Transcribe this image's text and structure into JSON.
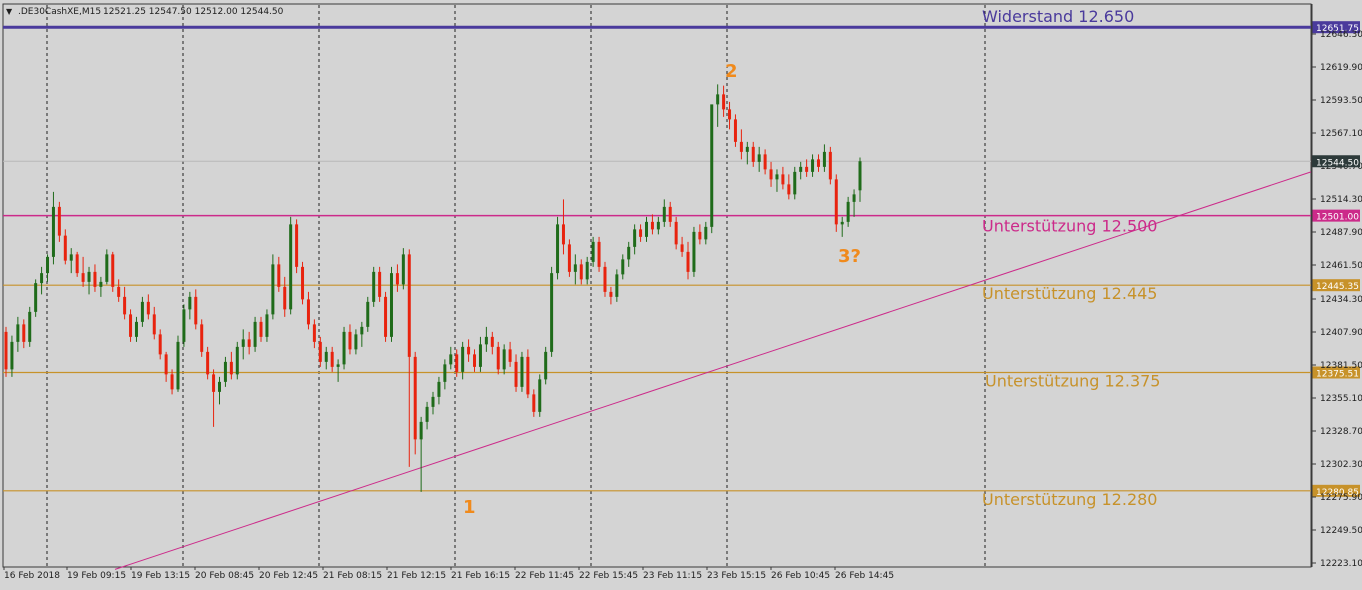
{
  "header": {
    "dropdown_glyph": "▼",
    "symbol": ".DE30CashXE,M15",
    "ohlc": "12521.25 12547.50 12512.00 12544.50"
  },
  "chart_data": {
    "type": "candlestick",
    "symbol": ".DE30CashXE",
    "timeframe": "M15",
    "ylim": [
      12223.1,
      12672.0
    ],
    "y_ticks": [
      "12646.30",
      "12619.90",
      "12593.50",
      "12567.10",
      "12540.70",
      "12514.30",
      "12487.90",
      "12461.50",
      "12434.30",
      "12407.90",
      "12381.50",
      "12355.10",
      "12328.70",
      "12302.30",
      "12275.90",
      "12249.50",
      "12223.10"
    ],
    "x_ticks": [
      "16 Feb 2018",
      "19 Feb 09:15",
      "19 Feb 13:15",
      "20 Feb 08:45",
      "20 Feb 12:45",
      "21 Feb 08:15",
      "21 Feb 12:15",
      "21 Feb 16:15",
      "22 Feb 11:45",
      "22 Feb 15:45",
      "23 Feb 11:15",
      "23 Feb 15:15",
      "26 Feb 10:45",
      "26 Feb 14:45"
    ],
    "grid": "vertical dashed at day separators",
    "current_price": 12544.5,
    "levels": [
      {
        "label": "Widerstand 12.650",
        "price": 12651.75,
        "price_label": "12651.75",
        "color": "#4a3a9c"
      },
      {
        "label": "Unterstützung 12.500",
        "price": 12501.0,
        "price_label": "12501.00",
        "color": "#cc2a8a"
      },
      {
        "label": "Unterstützung 12.445",
        "price": 12445.35,
        "price_label": "12445.35",
        "color": "#c7922a"
      },
      {
        "label": "Unterstützung 12.375",
        "price": 12375.51,
        "price_label": "12375.51",
        "color": "#c7922a"
      },
      {
        "label": "Unterstützung 12.280",
        "price": 12280.85,
        "price_label": "12280.85",
        "color": "#c7922a"
      }
    ],
    "trendline": {
      "start_price": 12218.0,
      "end_price": 12536.0,
      "color": "#cc2a8a"
    },
    "annotations": [
      "1",
      "2",
      "3?"
    ],
    "candles": [
      {
        "o": 12408,
        "h": 12412,
        "l": 12372,
        "c": 12378
      },
      {
        "o": 12378,
        "h": 12405,
        "l": 12372,
        "c": 12400
      },
      {
        "o": 12400,
        "h": 12420,
        "l": 12392,
        "c": 12414
      },
      {
        "o": 12414,
        "h": 12418,
        "l": 12395,
        "c": 12400
      },
      {
        "o": 12400,
        "h": 12428,
        "l": 12396,
        "c": 12424
      },
      {
        "o": 12424,
        "h": 12450,
        "l": 12420,
        "c": 12447
      },
      {
        "o": 12447,
        "h": 12460,
        "l": 12438,
        "c": 12455
      },
      {
        "o": 12455,
        "h": 12470,
        "l": 12448,
        "c": 12468
      },
      {
        "o": 12468,
        "h": 12520,
        "l": 12462,
        "c": 12508
      },
      {
        "o": 12508,
        "h": 12512,
        "l": 12480,
        "c": 12485
      },
      {
        "o": 12485,
        "h": 12490,
        "l": 12462,
        "c": 12465
      },
      {
        "o": 12465,
        "h": 12475,
        "l": 12455,
        "c": 12470
      },
      {
        "o": 12470,
        "h": 12472,
        "l": 12452,
        "c": 12455
      },
      {
        "o": 12455,
        "h": 12468,
        "l": 12444,
        "c": 12448
      },
      {
        "o": 12448,
        "h": 12460,
        "l": 12438,
        "c": 12456
      },
      {
        "o": 12456,
        "h": 12462,
        "l": 12440,
        "c": 12444
      },
      {
        "o": 12444,
        "h": 12452,
        "l": 12436,
        "c": 12448
      },
      {
        "o": 12448,
        "h": 12474,
        "l": 12446,
        "c": 12470
      },
      {
        "o": 12470,
        "h": 12472,
        "l": 12440,
        "c": 12444
      },
      {
        "o": 12444,
        "h": 12450,
        "l": 12432,
        "c": 12436
      },
      {
        "o": 12436,
        "h": 12444,
        "l": 12418,
        "c": 12422
      },
      {
        "o": 12422,
        "h": 12426,
        "l": 12400,
        "c": 12404
      },
      {
        "o": 12404,
        "h": 12420,
        "l": 12400,
        "c": 12416
      },
      {
        "o": 12416,
        "h": 12436,
        "l": 12412,
        "c": 12432
      },
      {
        "o": 12432,
        "h": 12438,
        "l": 12418,
        "c": 12422
      },
      {
        "o": 12422,
        "h": 12428,
        "l": 12402,
        "c": 12406
      },
      {
        "o": 12406,
        "h": 12410,
        "l": 12386,
        "c": 12390
      },
      {
        "o": 12390,
        "h": 12392,
        "l": 12368,
        "c": 12374
      },
      {
        "o": 12374,
        "h": 12378,
        "l": 12358,
        "c": 12362
      },
      {
        "o": 12362,
        "h": 12405,
        "l": 12360,
        "c": 12400
      },
      {
        "o": 12400,
        "h": 12430,
        "l": 12396,
        "c": 12426
      },
      {
        "o": 12426,
        "h": 12440,
        "l": 12418,
        "c": 12436
      },
      {
        "o": 12436,
        "h": 12442,
        "l": 12410,
        "c": 12414
      },
      {
        "o": 12414,
        "h": 12418,
        "l": 12388,
        "c": 12392
      },
      {
        "o": 12392,
        "h": 12396,
        "l": 12370,
        "c": 12374
      },
      {
        "o": 12374,
        "h": 12378,
        "l": 12332,
        "c": 12360
      },
      {
        "o": 12360,
        "h": 12372,
        "l": 12350,
        "c": 12368
      },
      {
        "o": 12368,
        "h": 12388,
        "l": 12364,
        "c": 12384
      },
      {
        "o": 12384,
        "h": 12392,
        "l": 12370,
        "c": 12374
      },
      {
        "o": 12374,
        "h": 12400,
        "l": 12370,
        "c": 12396
      },
      {
        "o": 12396,
        "h": 12410,
        "l": 12386,
        "c": 12402
      },
      {
        "o": 12402,
        "h": 12408,
        "l": 12390,
        "c": 12396
      },
      {
        "o": 12396,
        "h": 12420,
        "l": 12392,
        "c": 12416
      },
      {
        "o": 12416,
        "h": 12420,
        "l": 12400,
        "c": 12404
      },
      {
        "o": 12404,
        "h": 12426,
        "l": 12400,
        "c": 12422
      },
      {
        "o": 12422,
        "h": 12470,
        "l": 12418,
        "c": 12462
      },
      {
        "o": 12462,
        "h": 12468,
        "l": 12440,
        "c": 12444
      },
      {
        "o": 12444,
        "h": 12452,
        "l": 12420,
        "c": 12426
      },
      {
        "o": 12426,
        "h": 12500,
        "l": 12422,
        "c": 12494
      },
      {
        "o": 12494,
        "h": 12498,
        "l": 12455,
        "c": 12460
      },
      {
        "o": 12460,
        "h": 12464,
        "l": 12430,
        "c": 12434
      },
      {
        "o": 12434,
        "h": 12440,
        "l": 12410,
        "c": 12414
      },
      {
        "o": 12414,
        "h": 12418,
        "l": 12395,
        "c": 12400
      },
      {
        "o": 12400,
        "h": 12404,
        "l": 12380,
        "c": 12384
      },
      {
        "o": 12384,
        "h": 12396,
        "l": 12378,
        "c": 12392
      },
      {
        "o": 12392,
        "h": 12396,
        "l": 12376,
        "c": 12380
      },
      {
        "o": 12380,
        "h": 12386,
        "l": 12368,
        "c": 12382
      },
      {
        "o": 12382,
        "h": 12412,
        "l": 12378,
        "c": 12408
      },
      {
        "o": 12408,
        "h": 12414,
        "l": 12390,
        "c": 12394
      },
      {
        "o": 12394,
        "h": 12410,
        "l": 12390,
        "c": 12406
      },
      {
        "o": 12406,
        "h": 12416,
        "l": 12396,
        "c": 12412
      },
      {
        "o": 12412,
        "h": 12436,
        "l": 12408,
        "c": 12432
      },
      {
        "o": 12432,
        "h": 12460,
        "l": 12428,
        "c": 12456
      },
      {
        "o": 12456,
        "h": 12460,
        "l": 12432,
        "c": 12436
      },
      {
        "o": 12436,
        "h": 12440,
        "l": 12400,
        "c": 12404
      },
      {
        "o": 12404,
        "h": 12460,
        "l": 12400,
        "c": 12455
      },
      {
        "o": 12455,
        "h": 12462,
        "l": 12440,
        "c": 12446
      },
      {
        "o": 12446,
        "h": 12475,
        "l": 12442,
        "c": 12470
      },
      {
        "o": 12470,
        "h": 12474,
        "l": 12300,
        "c": 12388
      },
      {
        "o": 12388,
        "h": 12392,
        "l": 12310,
        "c": 12322
      },
      {
        "o": 12322,
        "h": 12340,
        "l": 12280,
        "c": 12336
      },
      {
        "o": 12336,
        "h": 12352,
        "l": 12330,
        "c": 12348
      },
      {
        "o": 12348,
        "h": 12360,
        "l": 12342,
        "c": 12356
      },
      {
        "o": 12356,
        "h": 12372,
        "l": 12350,
        "c": 12368
      },
      {
        "o": 12368,
        "h": 12386,
        "l": 12362,
        "c": 12382
      },
      {
        "o": 12382,
        "h": 12396,
        "l": 12378,
        "c": 12390
      },
      {
        "o": 12390,
        "h": 12394,
        "l": 12372,
        "c": 12376
      },
      {
        "o": 12376,
        "h": 12400,
        "l": 12370,
        "c": 12396
      },
      {
        "o": 12396,
        "h": 12402,
        "l": 12384,
        "c": 12390
      },
      {
        "o": 12390,
        "h": 12394,
        "l": 12376,
        "c": 12380
      },
      {
        "o": 12380,
        "h": 12404,
        "l": 12376,
        "c": 12398
      },
      {
        "o": 12398,
        "h": 12412,
        "l": 12392,
        "c": 12404
      },
      {
        "o": 12404,
        "h": 12408,
        "l": 12390,
        "c": 12396
      },
      {
        "o": 12396,
        "h": 12400,
        "l": 12374,
        "c": 12378
      },
      {
        "o": 12378,
        "h": 12398,
        "l": 12374,
        "c": 12394
      },
      {
        "o": 12394,
        "h": 12400,
        "l": 12380,
        "c": 12384
      },
      {
        "o": 12384,
        "h": 12390,
        "l": 12360,
        "c": 12364
      },
      {
        "o": 12364,
        "h": 12392,
        "l": 12360,
        "c": 12388
      },
      {
        "o": 12388,
        "h": 12394,
        "l": 12355,
        "c": 12358
      },
      {
        "o": 12358,
        "h": 12362,
        "l": 12340,
        "c": 12344
      },
      {
        "o": 12344,
        "h": 12374,
        "l": 12340,
        "c": 12370
      },
      {
        "o": 12370,
        "h": 12396,
        "l": 12366,
        "c": 12392
      },
      {
        "o": 12392,
        "h": 12460,
        "l": 12388,
        "c": 12455
      },
      {
        "o": 12455,
        "h": 12500,
        "l": 12450,
        "c": 12494
      },
      {
        "o": 12494,
        "h": 12514,
        "l": 12470,
        "c": 12478
      },
      {
        "o": 12478,
        "h": 12482,
        "l": 12452,
        "c": 12456
      },
      {
        "o": 12456,
        "h": 12470,
        "l": 12446,
        "c": 12462
      },
      {
        "o": 12462,
        "h": 12466,
        "l": 12446,
        "c": 12450
      },
      {
        "o": 12450,
        "h": 12468,
        "l": 12446,
        "c": 12464
      },
      {
        "o": 12464,
        "h": 12484,
        "l": 12460,
        "c": 12480
      },
      {
        "o": 12480,
        "h": 12484,
        "l": 12456,
        "c": 12460
      },
      {
        "o": 12460,
        "h": 12464,
        "l": 12436,
        "c": 12440
      },
      {
        "o": 12440,
        "h": 12444,
        "l": 12430,
        "c": 12436
      },
      {
        "o": 12436,
        "h": 12458,
        "l": 12432,
        "c": 12454
      },
      {
        "o": 12454,
        "h": 12470,
        "l": 12450,
        "c": 12466
      },
      {
        "o": 12466,
        "h": 12480,
        "l": 12460,
        "c": 12476
      },
      {
        "o": 12476,
        "h": 12494,
        "l": 12470,
        "c": 12490
      },
      {
        "o": 12490,
        "h": 12494,
        "l": 12480,
        "c": 12484
      },
      {
        "o": 12484,
        "h": 12500,
        "l": 12480,
        "c": 12496
      },
      {
        "o": 12496,
        "h": 12502,
        "l": 12486,
        "c": 12490
      },
      {
        "o": 12490,
        "h": 12500,
        "l": 12486,
        "c": 12496
      },
      {
        "o": 12496,
        "h": 12514,
        "l": 12492,
        "c": 12508
      },
      {
        "o": 12508,
        "h": 12512,
        "l": 12492,
        "c": 12496
      },
      {
        "o": 12496,
        "h": 12500,
        "l": 12474,
        "c": 12478
      },
      {
        "o": 12478,
        "h": 12484,
        "l": 12468,
        "c": 12472
      },
      {
        "o": 12472,
        "h": 12480,
        "l": 12450,
        "c": 12456
      },
      {
        "o": 12456,
        "h": 12492,
        "l": 12452,
        "c": 12488
      },
      {
        "o": 12488,
        "h": 12494,
        "l": 12478,
        "c": 12482
      },
      {
        "o": 12482,
        "h": 12496,
        "l": 12478,
        "c": 12492
      },
      {
        "o": 12492,
        "h": 12560,
        "l": 12487,
        "c": 12590
      },
      {
        "o": 12590,
        "h": 12606,
        "l": 12572,
        "c": 12598
      },
      {
        "o": 12598,
        "h": 12605,
        "l": 12580,
        "c": 12586
      },
      {
        "o": 12586,
        "h": 12592,
        "l": 12570,
        "c": 12578
      },
      {
        "o": 12578,
        "h": 12582,
        "l": 12556,
        "c": 12560
      },
      {
        "o": 12560,
        "h": 12570,
        "l": 12546,
        "c": 12552
      },
      {
        "o": 12552,
        "h": 12560,
        "l": 12542,
        "c": 12556
      },
      {
        "o": 12556,
        "h": 12560,
        "l": 12540,
        "c": 12544
      },
      {
        "o": 12544,
        "h": 12556,
        "l": 12536,
        "c": 12550
      },
      {
        "o": 12550,
        "h": 12554,
        "l": 12534,
        "c": 12538
      },
      {
        "o": 12538,
        "h": 12544,
        "l": 12524,
        "c": 12530
      },
      {
        "o": 12530,
        "h": 12538,
        "l": 12520,
        "c": 12534
      },
      {
        "o": 12534,
        "h": 12540,
        "l": 12522,
        "c": 12526
      },
      {
        "o": 12526,
        "h": 12534,
        "l": 12514,
        "c": 12518
      },
      {
        "o": 12518,
        "h": 12540,
        "l": 12514,
        "c": 12536
      },
      {
        "o": 12536,
        "h": 12544,
        "l": 12530,
        "c": 12540
      },
      {
        "o": 12540,
        "h": 12546,
        "l": 12532,
        "c": 12536
      },
      {
        "o": 12536,
        "h": 12550,
        "l": 12532,
        "c": 12546
      },
      {
        "o": 12546,
        "h": 12550,
        "l": 12536,
        "c": 12540
      },
      {
        "o": 12540,
        "h": 12558,
        "l": 12536,
        "c": 12552
      },
      {
        "o": 12552,
        "h": 12556,
        "l": 12526,
        "c": 12530
      },
      {
        "o": 12530,
        "h": 12534,
        "l": 12488,
        "c": 12494
      },
      {
        "o": 12494,
        "h": 12500,
        "l": 12484,
        "c": 12496
      },
      {
        "o": 12496,
        "h": 12516,
        "l": 12492,
        "c": 12512
      },
      {
        "o": 12512,
        "h": 12522,
        "l": 12500,
        "c": 12518
      },
      {
        "o": 12521.25,
        "h": 12547.5,
        "l": 12512,
        "c": 12544.5
      }
    ]
  },
  "colors": {
    "background": "#d4d4d4",
    "bull": "#1f6b1a",
    "bear": "#e8230e",
    "grid": "#202020",
    "annotation": "#f08a1c"
  }
}
